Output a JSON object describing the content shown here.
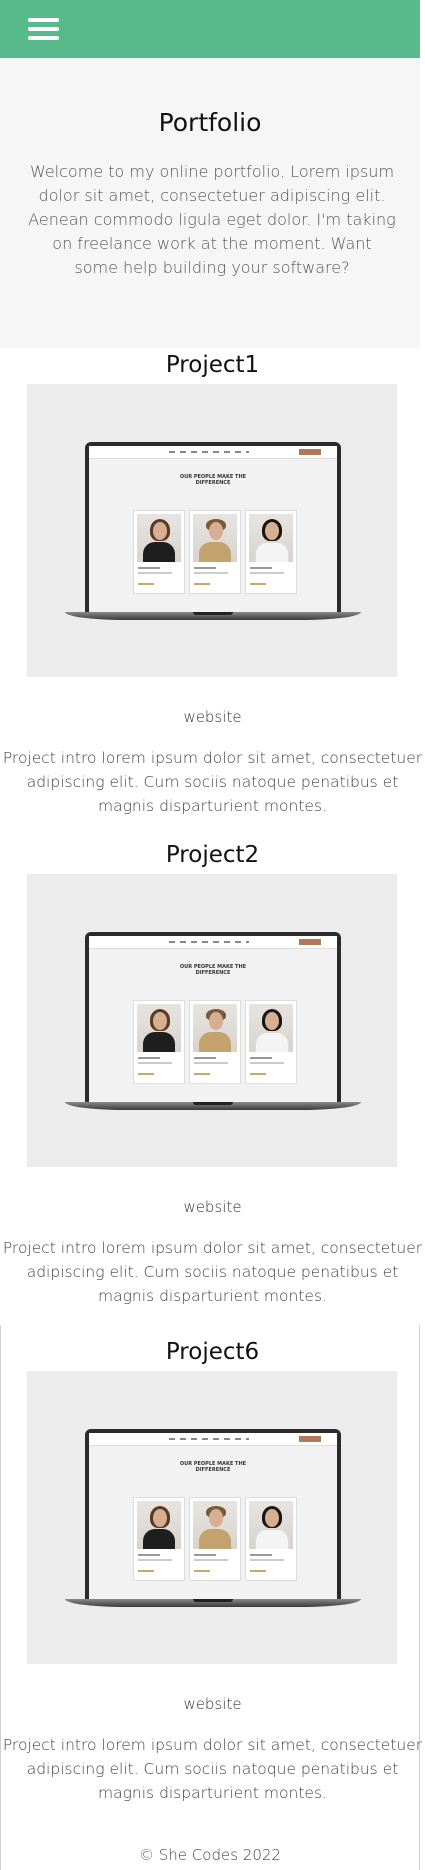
{
  "header": {
    "menu_icon": "hamburger-menu-icon",
    "background_color": "#58b98a"
  },
  "hero": {
    "title": "Portfolio",
    "intro": "Welcome to my online portfolio. Lorem ipsum dolor sit amet, consectetuer adipiscing elit. Aenean commodo ligula eget dolor. I'm taking on freelance work at the moment. Want some help building your software?"
  },
  "projects": [
    {
      "title": "Project1",
      "tag": "website",
      "description": "Project intro lorem ipsum dolor sit amet, consectetuer adipiscing elit. Cum sociis natoque penatibus et magnis disparturient montes."
    },
    {
      "title": "Project2",
      "tag": "website",
      "description": "Project intro lorem ipsum dolor sit amet, consectetuer adipiscing elit. Cum sociis natoque penatibus et magnis disparturient montes."
    },
    {
      "title": "Project6",
      "tag": "website",
      "description": "Project intro lorem ipsum dolor sit amet, consectetuer adipiscing elit. Cum sociis natoque penatibus et magnis disparturient montes."
    }
  ],
  "mockup": {
    "heading_line1": "OUR PEOPLE MAKE THE",
    "heading_line2": "DIFFERENCE"
  },
  "footer": {
    "text": "© She Codes 2022"
  }
}
